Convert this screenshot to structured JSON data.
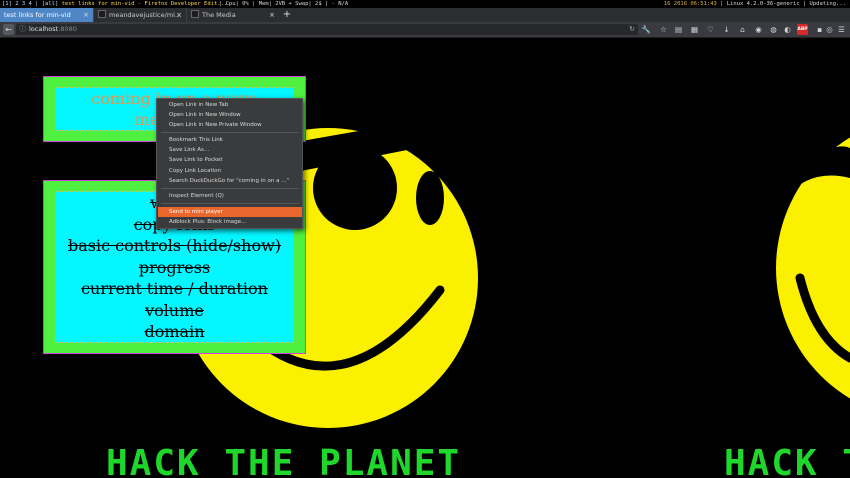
{
  "status_bar": {
    "workspaces": "[1] 2 3 4 |",
    "layout": "[all]",
    "window_title": "test links for min-vid - Firefox Developer Edit...",
    "stats": "| Cpu| 0% | Mem| 2VB + Swap| 2$ |   - N/A",
    "timestamp": "16 2016 06:51:43",
    "system": "| Linux 4.2.0-36-generic | Updating..."
  },
  "tabs": [
    {
      "label": "test links for min-vid",
      "active": true
    },
    {
      "label": "meandavejustice/mi...",
      "active": false
    },
    {
      "label": "The Media",
      "active": false
    }
  ],
  "tab_close_glyph": "×",
  "new_tab_glyph": "+",
  "nav": {
    "back_glyph": "←",
    "url_host": "localhost",
    "url_port": ":8080",
    "info_glyph": "ⓘ",
    "reload_glyph": "↻"
  },
  "toolbar_icons": [
    {
      "name": "tools-icon",
      "glyph": "🔧"
    },
    {
      "name": "bookmark-star-icon",
      "glyph": "☆"
    },
    {
      "name": "reading-list-icon",
      "glyph": "▤"
    },
    {
      "name": "bookmarks-menu-icon",
      "glyph": "▦"
    },
    {
      "name": "pocket-icon",
      "glyph": "♡"
    },
    {
      "name": "downloads-icon",
      "glyph": "↓"
    },
    {
      "name": "home-icon",
      "glyph": "⌂"
    },
    {
      "name": "addon-icon-1",
      "glyph": "◉"
    },
    {
      "name": "addon-icon-2",
      "glyph": "◍"
    },
    {
      "name": "addon-icon-3",
      "glyph": "◐"
    },
    {
      "name": "adblock-plus-icon",
      "glyph": "ABP"
    },
    {
      "name": "addon-icon-4",
      "glyph": "▪"
    },
    {
      "name": "extension-icon",
      "glyph": "◎"
    },
    {
      "name": "hamburger-menu-icon",
      "glyph": "☰"
    }
  ],
  "box1_links": [
    "coming in on a wave",
    "memories"
  ],
  "box2_links": [
    "watch",
    "copy folks",
    "basic controls (hide/show)",
    "progress",
    "current time / duration",
    "volume",
    "domain"
  ],
  "banner_text": "HACK THE PLANET",
  "context_menu": [
    "Open Link in New Tab",
    "Open Link in New Window",
    "Open Link in New Private Window",
    "Bookmark This Link",
    "Save Link As…",
    "Save Link to Pocket",
    "Copy Link Location",
    "Search DuckDuckGo for \"coming in on a ...\"",
    "Inspect Element (Q)",
    "Send to mini player",
    "Adblock Plus: Block image…"
  ],
  "colors": {
    "smiley_yellow": "#fbf000",
    "hack_green": "#1fd62a",
    "box_green": "#4ff03f",
    "box_cyan": "#04f6ff",
    "menu_highlight": "#e9662c",
    "active_tab": "#4f86c6"
  }
}
